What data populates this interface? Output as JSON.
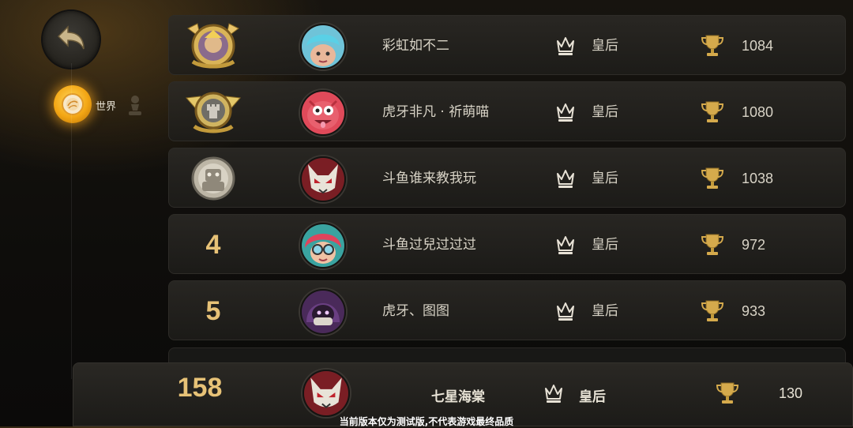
{
  "sidebar": {
    "back_icon": "back-arrow-icon",
    "world_tab": {
      "label": "世界",
      "icon": "world-icon"
    }
  },
  "leaderboard": {
    "rows": [
      {
        "rank": "1",
        "rank_display": "badge",
        "badge_icon": "gold-rank-badge-icon",
        "avatar_icon": "cyan-hair-avatar",
        "name": "彩虹如不二",
        "title": "皇后",
        "score": "1084"
      },
      {
        "rank": "2",
        "rank_display": "badge",
        "badge_icon": "gold-rook-badge-icon",
        "avatar_icon": "red-monster-avatar",
        "name": "虎牙非凡 · 祈萌喵",
        "title": "皇后",
        "score": "1080"
      },
      {
        "rank": "3",
        "rank_display": "badge",
        "badge_icon": "silver-robot-badge-icon",
        "avatar_icon": "fox-mask-avatar",
        "name": "斗鱼谁来教我玩",
        "title": "皇后",
        "score": "1038"
      },
      {
        "rank": "4",
        "rank_display": "number",
        "avatar_icon": "red-hair-goggles-avatar",
        "name": "斗鱼过兒过过过",
        "title": "皇后",
        "score": "972"
      },
      {
        "rank": "5",
        "rank_display": "number",
        "avatar_icon": "purple-hood-avatar",
        "name": "虎牙、图图",
        "title": "皇后",
        "score": "933"
      }
    ]
  },
  "self": {
    "rank": "158",
    "avatar_icon": "fox-mask-avatar",
    "name": "七星海棠",
    "title": "皇后",
    "score": "130"
  },
  "disclaimer": "当前版本仅为测试版,不代表游戏最终品质",
  "colors": {
    "rank_gold": "#e7c277",
    "accent_orange": "#f3a614",
    "row_bg": "#26241f"
  }
}
